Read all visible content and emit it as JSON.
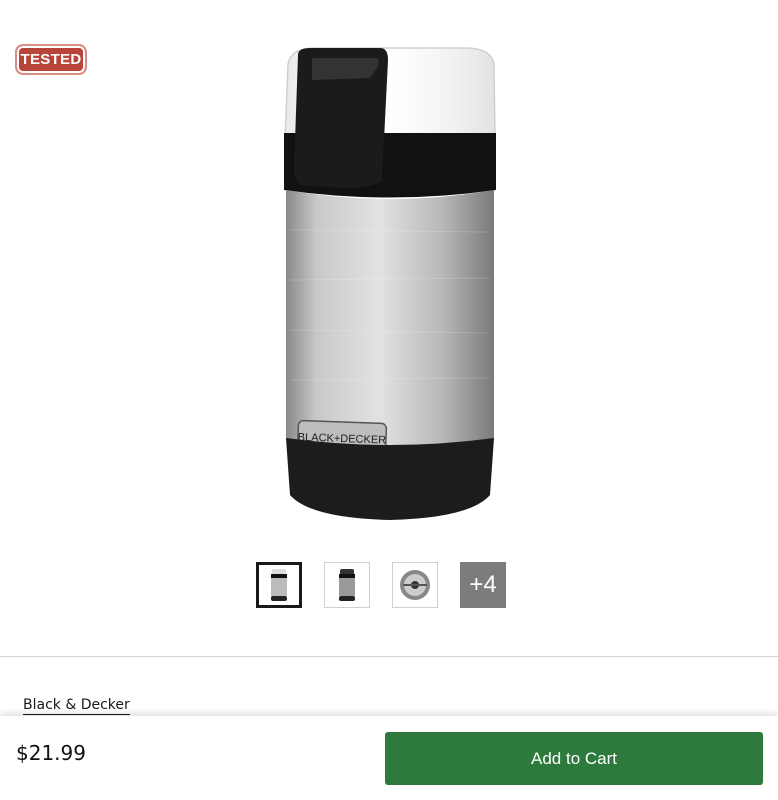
{
  "badge": {
    "label": "TESTED",
    "color": "#b8443a"
  },
  "product": {
    "image_icon": "coffee-grinder-image",
    "logo_text": "BLACK+DECKER",
    "brand": "Black & Decker",
    "price": "$21.99"
  },
  "gallery": {
    "more_label": "+4"
  },
  "actions": {
    "add_to_cart_label": "Add to Cart",
    "accent": "#2e7a3c"
  }
}
